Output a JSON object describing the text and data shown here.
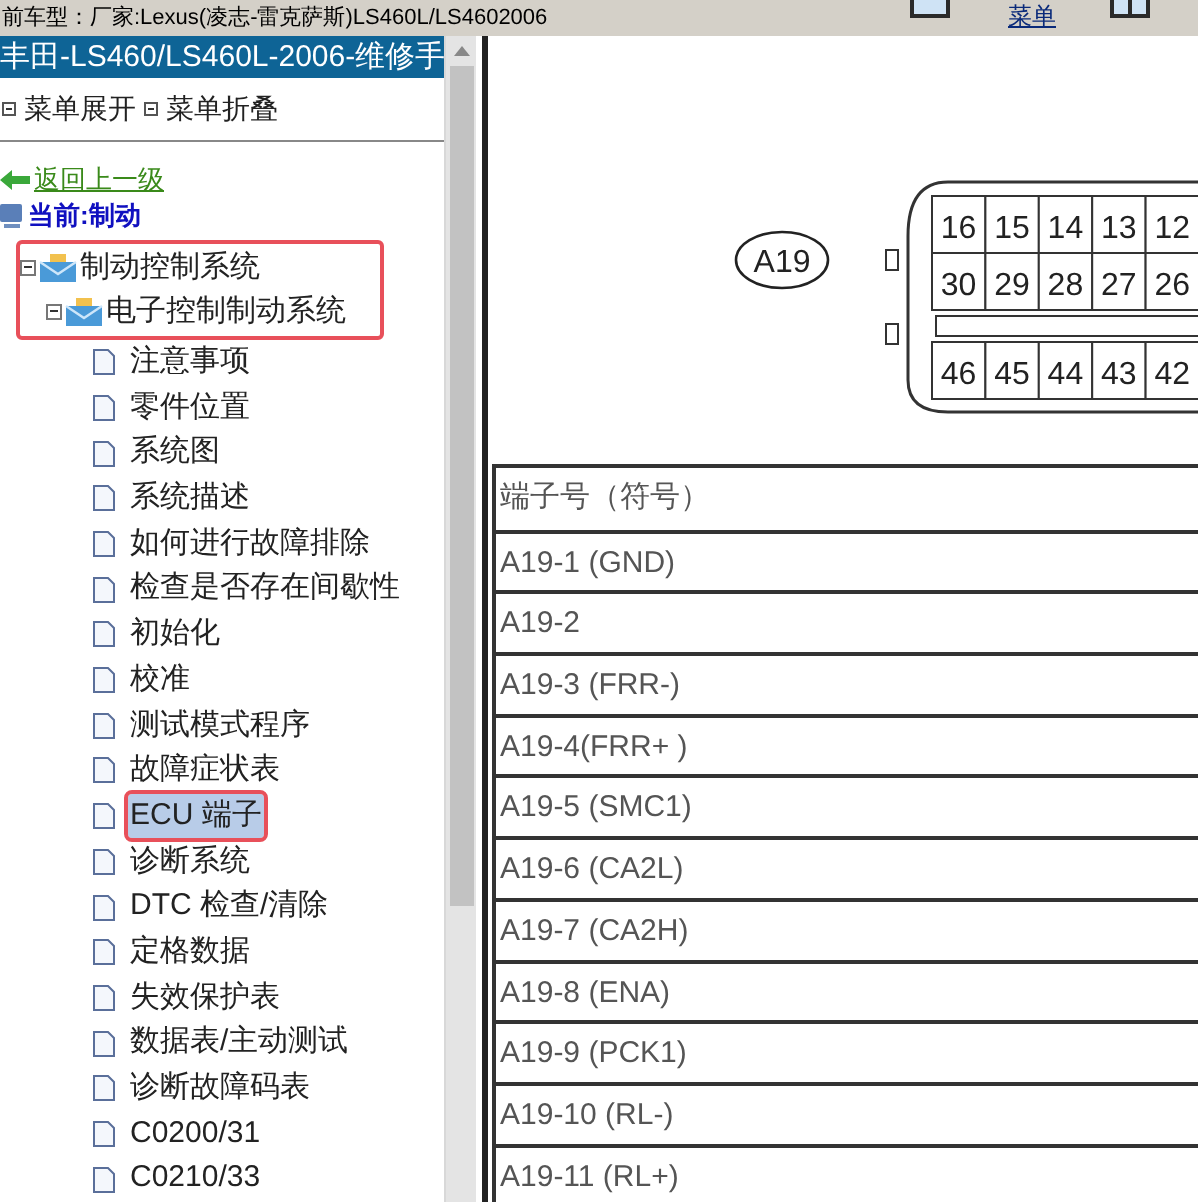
{
  "top_bar": {
    "model_text": "前车型：厂家:Lexus(凌志-雷克萨斯)LS460L/LS4602006",
    "menu_link": "菜单"
  },
  "sidebar": {
    "title": "丰田-LS460/LS460L-2006-维修手",
    "menu_actions": [
      "菜单展开",
      "菜单折叠"
    ],
    "back_link": "返回上一级",
    "current": "当前:制动",
    "tree": [
      {
        "label": "制动控制系统",
        "outlined": true,
        "expanded": true,
        "children": [
          {
            "label": "电子控制制动系统",
            "outlined": true,
            "expanded": true,
            "children": [
              {
                "label": "注意事项",
                "selected": false,
                "outlined": false
              },
              {
                "label": "零件位置",
                "selected": false,
                "outlined": false
              },
              {
                "label": "系统图",
                "selected": false,
                "outlined": false
              },
              {
                "label": "系统描述",
                "selected": false,
                "outlined": false
              },
              {
                "label": "如何进行故障排除",
                "selected": false,
                "outlined": false
              },
              {
                "label": "检查是否存在间歇性",
                "selected": false,
                "outlined": false
              },
              {
                "label": "初始化",
                "selected": false,
                "outlined": false
              },
              {
                "label": "校准",
                "selected": false,
                "outlined": false
              },
              {
                "label": "测试模式程序",
                "selected": false,
                "outlined": false
              },
              {
                "label": "故障症状表",
                "selected": false,
                "outlined": false
              },
              {
                "label": "ECU 端子",
                "selected": true,
                "outlined": true
              },
              {
                "label": "诊断系统",
                "selected": false,
                "outlined": false
              },
              {
                "label": "DTC 检查/清除",
                "selected": false,
                "outlined": false
              },
              {
                "label": "定格数据",
                "selected": false,
                "outlined": false
              },
              {
                "label": "失效保护表",
                "selected": false,
                "outlined": false
              },
              {
                "label": "数据表/主动测试",
                "selected": false,
                "outlined": false
              },
              {
                "label": "诊断故障码表",
                "selected": false,
                "outlined": false
              },
              {
                "label": "C0200/31",
                "selected": false,
                "outlined": false
              },
              {
                "label": "C0210/33",
                "selected": false,
                "outlined": false
              }
            ]
          }
        ]
      }
    ]
  },
  "connector": {
    "label": "A19",
    "rows": [
      [
        "16",
        "15",
        "14",
        "13",
        "12"
      ],
      [
        "30",
        "29",
        "28",
        "27",
        "26"
      ],
      [
        "46",
        "45",
        "44",
        "43",
        "42"
      ]
    ]
  },
  "table": {
    "header": "端子号（符号）",
    "rows": [
      "A19-1 (GND)",
      "A19-2",
      "A19-3 (FRR-)",
      "A19-4(FRR+ )",
      "A19-5 (SMC1)",
      "A19-6 (CA2L)",
      "A19-7 (CA2H)",
      "A19-8 (ENA)",
      "A19-9 (PCK1)",
      "A19-10 (RL-)",
      "A19-11 (RL+)"
    ]
  }
}
